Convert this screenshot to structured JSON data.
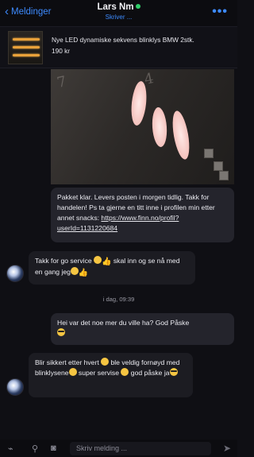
{
  "header": {
    "back_label": "Meldinger",
    "contact_name": "Lars N",
    "contact_name_tail": "m",
    "status": "Skriver ...",
    "online_color": "#2fcf6a",
    "more_icon": "more-dots-icon"
  },
  "listing": {
    "title": "Nye LED dynamiske sekvens blinklys BMW 2stk.",
    "price": "190 kr"
  },
  "messages": [
    {
      "side": "out",
      "kind": "photo"
    },
    {
      "side": "out",
      "text1": "Pakket klar. Levers posten i morgen tidlig. Takk for handelen! Ps ta gjerne en titt inne i profilen min etter annet snacks: ",
      "link": "https://www.finn.no/profil?userId=1131220684"
    },
    {
      "side": "in",
      "text_a": "Takk for go service ",
      "text_b": " skal inn og se nå med en gang jeg"
    },
    {
      "side": "out",
      "text": "Hei var det noe mer du ville ha? God Påske"
    },
    {
      "side": "in",
      "text_a": "Blir sikkert etter hvert ",
      "text_b": " ble veldig fornøyd med blinklysene",
      "text_c": " super servise ",
      "text_d": " god påske ja"
    }
  ],
  "divider": "i dag, 09:39",
  "composer": {
    "placeholder": "Skriv melding ..."
  },
  "colors": {
    "accent": "#3d8bff",
    "background": "#0f0f14",
    "bubble": "#1c1c22"
  }
}
